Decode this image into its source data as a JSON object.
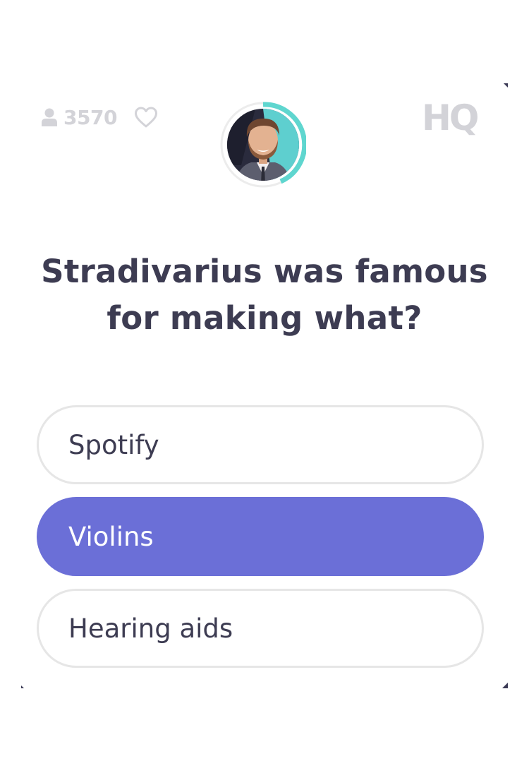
{
  "header": {
    "viewer_count": "3570",
    "logo_text": "HQ",
    "icons": {
      "viewers": "person-icon",
      "lives": "heart-icon",
      "host": "host-avatar"
    }
  },
  "question": {
    "text": "Stradivarius was famous for making what?"
  },
  "answers": [
    {
      "label": "Spotify",
      "selected": false
    },
    {
      "label": "Violins",
      "selected": true
    },
    {
      "label": "Hearing aids",
      "selected": false
    }
  ],
  "colors": {
    "accent": "#6b6fd7",
    "timer_ring": "#5fd6cf",
    "text_dark": "#3d3c52",
    "muted": "#d3d3d8"
  }
}
